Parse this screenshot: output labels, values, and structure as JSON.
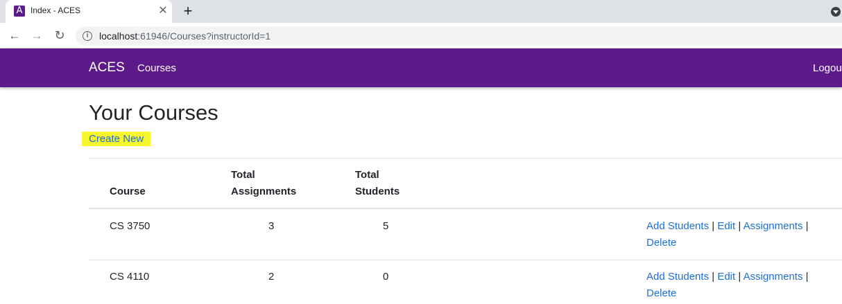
{
  "browser": {
    "tab_title": "Index - ACES",
    "favicon_letter": "A",
    "close_glyph": "✕",
    "new_tab_glyph": "+",
    "back_glyph": "←",
    "forward_glyph": "→",
    "reload_glyph": "↻",
    "info_glyph": "i",
    "url_host": "localhost",
    "url_rest": ":61946/Courses?instructorId=1"
  },
  "navbar": {
    "brand": "ACES",
    "courses_link": "Courses",
    "logout_link": "Logout",
    "color": "#5c1a8a"
  },
  "main": {
    "title": "Your Courses",
    "create_new": "Create New",
    "highlight_color": "#f7f72c"
  },
  "table": {
    "headers": {
      "course": "Course",
      "assignments_line1": "Total",
      "assignments_line2": "Assignments",
      "students_line1": "Total",
      "students_line2": "Students"
    },
    "rows": [
      {
        "course": "CS 3750",
        "assignments": "3",
        "students": "5",
        "actions": {
          "add_students": "Add Students",
          "edit": "Edit",
          "assignments": "Assignments",
          "delete": "Delete",
          "sep": "|"
        }
      },
      {
        "course": "CS 4110",
        "assignments": "2",
        "students": "0",
        "actions": {
          "add_students": "Add Students",
          "edit": "Edit",
          "assignments": "Assignments",
          "delete": "Delete",
          "sep": "|"
        }
      }
    ]
  },
  "link_color": "#1f6fd0"
}
